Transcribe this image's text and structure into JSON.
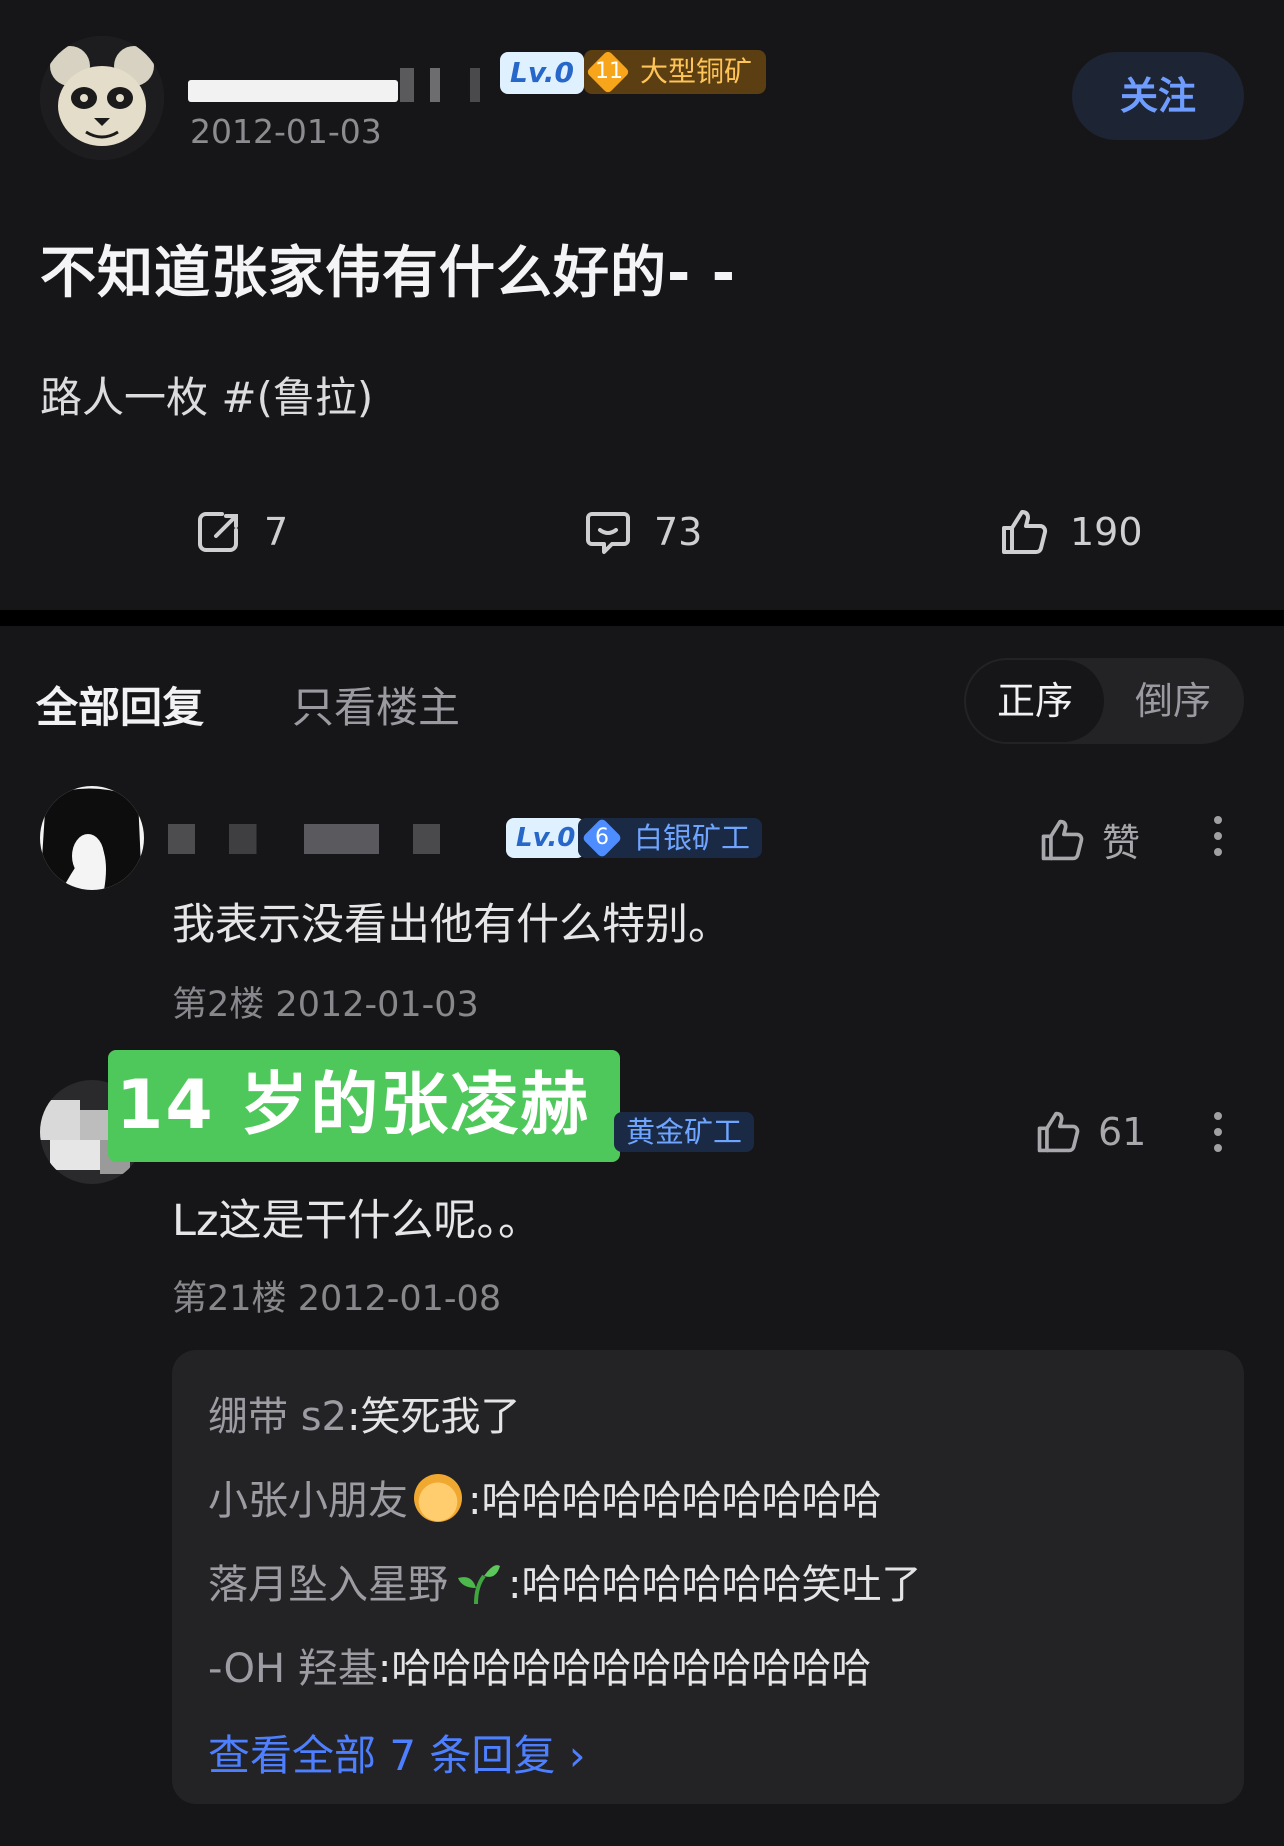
{
  "post": {
    "author_level": "Lv.0",
    "author_rank_num": "11",
    "author_rank": "大型铜矿",
    "date": "2012-01-03",
    "follow": "关注",
    "title": "不知道张家伟有什么好的- -",
    "body": "路人一枚 #(鲁拉)",
    "shares": "7",
    "comments": "73",
    "likes": "190"
  },
  "tabs": {
    "all": "全部回复",
    "op_only": "只看楼主",
    "sort_asc": "正序",
    "sort_desc": "倒序"
  },
  "replies": [
    {
      "level": "Lv.0",
      "rank_num": "6",
      "rank": "白银矿工",
      "text": "我表示没看出他有什么特别。",
      "floor": "第2楼",
      "date": "2012-01-03",
      "like_label": "赞"
    },
    {
      "overlay_caption": "14 岁的张凌赫",
      "rank": "黄金矿工",
      "text": "Lz这是干什么呢。。",
      "floor": "第21楼",
      "date": "2012-01-08",
      "likes": "61",
      "sub_replies": [
        {
          "name": "绷带 s2",
          "text": ":笑死我了"
        },
        {
          "name": "小张小朋友",
          "icon": "child-emoji",
          "text": ":哈哈哈哈哈哈哈哈哈哈"
        },
        {
          "name": "落月坠入星野",
          "icon": "seedling-emoji",
          "text": ":哈哈哈哈哈哈哈笑吐了"
        },
        {
          "name": "-OH 羟基",
          "text": ":哈哈哈哈哈哈哈哈哈哈哈哈"
        }
      ],
      "view_all": "查看全部 7 条回复 ›"
    }
  ],
  "colors": {
    "background": "#161618",
    "accent_blue": "#4d7fff",
    "overlay_green": "#4fc85b"
  }
}
